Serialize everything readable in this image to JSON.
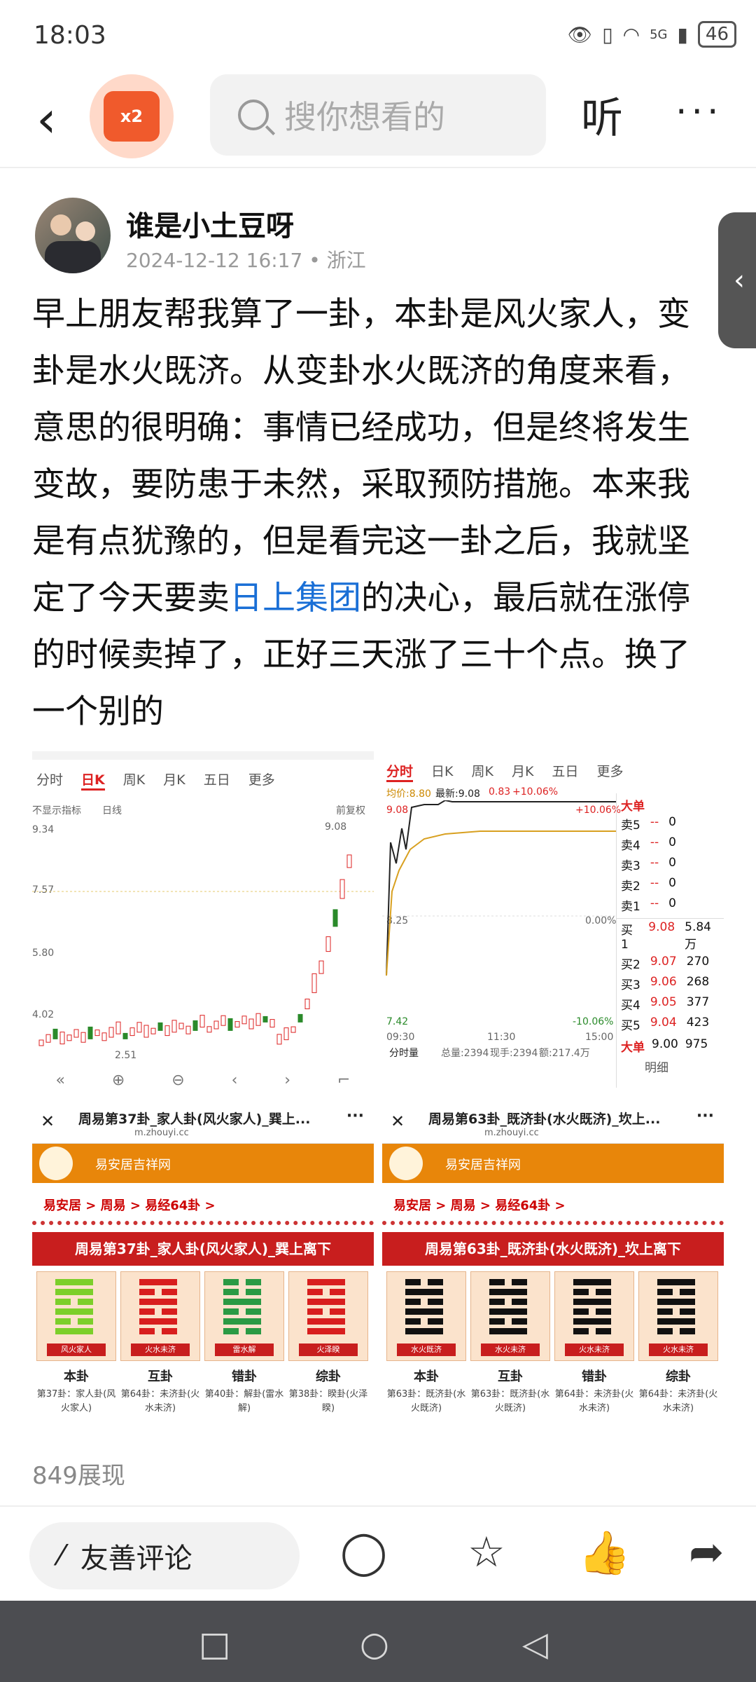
{
  "status": {
    "time": "18:03",
    "network": "5G",
    "battery": "46"
  },
  "nav": {
    "back_icon": "chevron-left-icon",
    "badge_text": "x2",
    "search_placeholder": "搜你想看的",
    "listen_label": "听",
    "more_label": "···"
  },
  "post": {
    "author": "谁是小土豆呀",
    "date": "2024-12-12 16:17",
    "location": "浙江",
    "text_before": "早上朋友帮我算了一卦，本卦是风火家人，变卦是水火既济。从变卦水火既济的角度来看，意思的很明确：事情已经成功，但是终将发生变故，要防患于未然，采取预防措施。本来我是有点犹豫的，但是看完这一卦之后，我就坚定了今天要卖",
    "link_text": "日上集团",
    "text_after": "的决心，最后就在涨停的时候卖掉了，正好三天涨了三十个点。换了一个别的",
    "views": "849展现"
  },
  "chart_left": {
    "tabs": [
      "分时",
      "日K",
      "周K",
      "月K",
      "五日",
      "更多"
    ],
    "active_tab": "日K",
    "indicator": "不显示指标",
    "line_type": "日线",
    "adjust": "前复权",
    "price_labels": [
      "9.34",
      "7.57",
      "5.80",
      "4.02"
    ],
    "high_label": "9.08",
    "low_label": "2.51"
  },
  "chart_right": {
    "tabs": [
      "分时",
      "日K",
      "周K",
      "月K",
      "五日",
      "更多"
    ],
    "active_tab": "分时",
    "avg_label": "均价:8.80",
    "latest_label": "最新:9.08",
    "change": "0.83",
    "change_pct": "+10.06%",
    "top_price": "9.08",
    "mid_price": "8.25",
    "bot_price": "7.42",
    "top_pct": "+10.06%",
    "mid_pct": "0.00%",
    "bot_pct": "-10.06%",
    "times": [
      "09:30",
      "11:30",
      "15:00"
    ],
    "volume_label": "分时量",
    "vol_total": "总量:2394",
    "vol_now": "现手:2394",
    "vol_amount": "额:217.4万",
    "big_order_label": "大单",
    "sells": [
      {
        "label": "卖5",
        "price": "--",
        "vol": "0"
      },
      {
        "label": "卖4",
        "price": "--",
        "vol": "0"
      },
      {
        "label": "卖3",
        "price": "--",
        "vol": "0"
      },
      {
        "label": "卖2",
        "price": "--",
        "vol": "0"
      },
      {
        "label": "卖1",
        "price": "--",
        "vol": "0"
      }
    ],
    "buys": [
      {
        "label": "买1",
        "price": "9.08",
        "vol": "5.84万"
      },
      {
        "label": "买2",
        "price": "9.07",
        "vol": "270"
      },
      {
        "label": "买3",
        "price": "9.06",
        "vol": "268"
      },
      {
        "label": "买4",
        "price": "9.05",
        "vol": "377"
      },
      {
        "label": "买5",
        "price": "9.04",
        "vol": "423"
      }
    ],
    "big_bottom": {
      "label": "大单",
      "price": "9.00",
      "vol": "975"
    },
    "detail_label": "明细"
  },
  "hex_left": {
    "page_title": "周易第37卦_家人卦(风火家人)_巽上...",
    "url": "m.zhouyi.cc",
    "site": "易安居吉祥网",
    "crumb": "易安居 > 周易 > 易经64卦 >",
    "title": "周易第37卦_家人卦(风火家人)_巽上离下",
    "cards": [
      {
        "caption": "风火家人",
        "label": "本卦",
        "desc": "第37卦：家人卦(风火家人)",
        "lines": [
          1,
          1,
          0,
          1,
          0,
          1
        ],
        "color": "#7ccf2a"
      },
      {
        "caption": "火水未济",
        "label": "互卦",
        "desc": "第64卦：未济卦(火水未济)",
        "lines": [
          1,
          0,
          1,
          0,
          1,
          0
        ],
        "color": "#d81e1e"
      },
      {
        "caption": "雷水解",
        "label": "错卦",
        "desc": "第40卦：解卦(雷水解)",
        "lines": [
          0,
          0,
          1,
          0,
          1,
          0
        ],
        "color": "#2a9a44"
      },
      {
        "caption": "火泽睽",
        "label": "综卦",
        "desc": "第38卦：睽卦(火泽睽)",
        "lines": [
          1,
          0,
          1,
          0,
          1,
          1
        ],
        "color": "#d81e1e"
      }
    ]
  },
  "hex_right": {
    "page_title": "周易第63卦_既济卦(水火既济)_坎上...",
    "url": "m.zhouyi.cc",
    "site": "易安居吉祥网",
    "crumb": "易安居 > 周易 > 易经64卦 >",
    "title": "周易第63卦_既济卦(水火既济)_坎上离下",
    "cards": [
      {
        "caption": "水火既济",
        "label": "本卦",
        "desc": "第63卦：既济卦(水火既济)",
        "lines": [
          0,
          1,
          0,
          1,
          0,
          1
        ],
        "color": "#111111"
      },
      {
        "caption": "水火未济",
        "label": "互卦",
        "desc": "第63卦：既济卦(水火既济)",
        "lines": [
          0,
          1,
          0,
          1,
          0,
          1
        ],
        "color": "#111111"
      },
      {
        "caption": "火水未济",
        "label": "错卦",
        "desc": "第64卦：未济卦(火水未济)",
        "lines": [
          1,
          0,
          1,
          0,
          1,
          0
        ],
        "color": "#111111"
      },
      {
        "caption": "火水未济",
        "label": "综卦",
        "desc": "第64卦：未济卦(火水未济)",
        "lines": [
          1,
          0,
          1,
          0,
          1,
          0
        ],
        "color": "#111111"
      }
    ]
  },
  "bottom": {
    "comment_placeholder": "友善评论",
    "icons": [
      "comment-icon",
      "star-icon",
      "like-icon",
      "share-icon"
    ]
  },
  "navbar": {
    "icons": [
      "square-icon",
      "circle-icon",
      "triangle-back-icon"
    ]
  }
}
